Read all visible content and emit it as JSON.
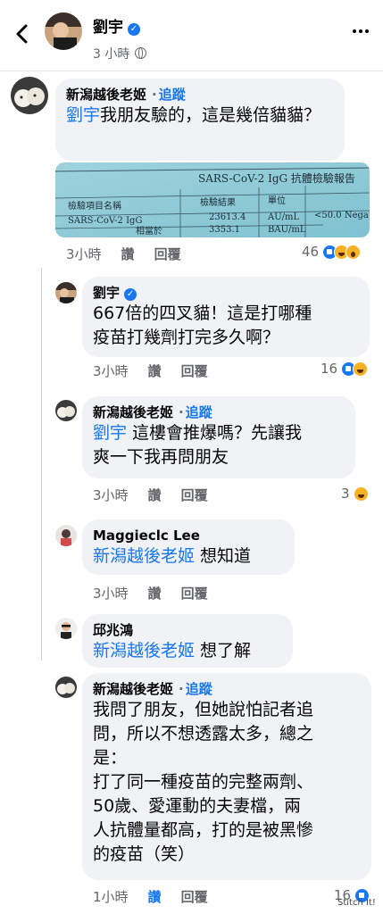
{
  "header": {
    "name": "劉宇",
    "time": "3 小時",
    "back_icon": "chevron-left-icon",
    "more_icon": "more-dots-icon"
  },
  "comments": [
    {
      "name": "新潟越後老姬",
      "follow": "追蹤",
      "dot": "·",
      "mention": "劉宇",
      "text": "我朋友驗的，這是幾倍貓貓？",
      "text_line2": "貓？",
      "attachment": {
        "title": "SARS-CoV-2 IgG 抗體檢驗報告",
        "col_item": "檢驗項目名稱",
        "col_result": "檢驗結果",
        "col_unit": "單位",
        "row1_item": "SARS-CoV-2 IgG",
        "row1_result": "23613.4",
        "row1_unit": "AU/mL",
        "row1_ref": "<50.0 Negat",
        "row2_item": "相當於",
        "row2_result": "3353.1",
        "row2_unit": "BAU/mL"
      },
      "time": "3小時",
      "like": "讚",
      "reply": "回覆",
      "reaction_count": "46"
    },
    {
      "name": "劉宇",
      "text_line1": "667倍的四叉貓！這是打哪種",
      "text_line2": "疫苗打幾劑打完多久啊？",
      "time": "3小時",
      "like": "讚",
      "reply": "回覆",
      "reaction_count": "16"
    },
    {
      "name": "新潟越後老姬",
      "follow": "追蹤",
      "dot": "·",
      "mention": "劉宇",
      "text_line1": " 這樓會推爆嗎？先讓我",
      "text_line2": "爽一下我再問朋友",
      "time": "3小時",
      "like": "讚",
      "reply": "回覆",
      "reaction_count": "3"
    },
    {
      "name": "Maggieclc Lee",
      "mention": "新潟越後老姬",
      "text": " 想知道",
      "time": "3小時",
      "like": "讚",
      "reply": "回覆"
    },
    {
      "name": "邱兆鴻",
      "mention": "新潟越後老姬",
      "text": " 想了解"
    },
    {
      "name": "新潟越後老姬",
      "follow": "追蹤",
      "dot": "·",
      "lines": [
        "我問了朋友，但她說怕記者追",
        "問，所以不想透露太多，總之",
        "是：",
        "打了同一種疫苗的完整兩劑、",
        "50歲、愛運動的夫妻檔，兩",
        "人抗體量都高，打的是被黑慘",
        "的疫苗（笑）"
      ],
      "time": "1小時",
      "like": "讚",
      "reply": "回覆",
      "reaction_count": "16"
    }
  ],
  "watermark": "Stitch It!",
  "colors": {
    "accent": "#1877f2",
    "bubble": "#f0f2f5",
    "secondary_text": "#65676b"
  }
}
